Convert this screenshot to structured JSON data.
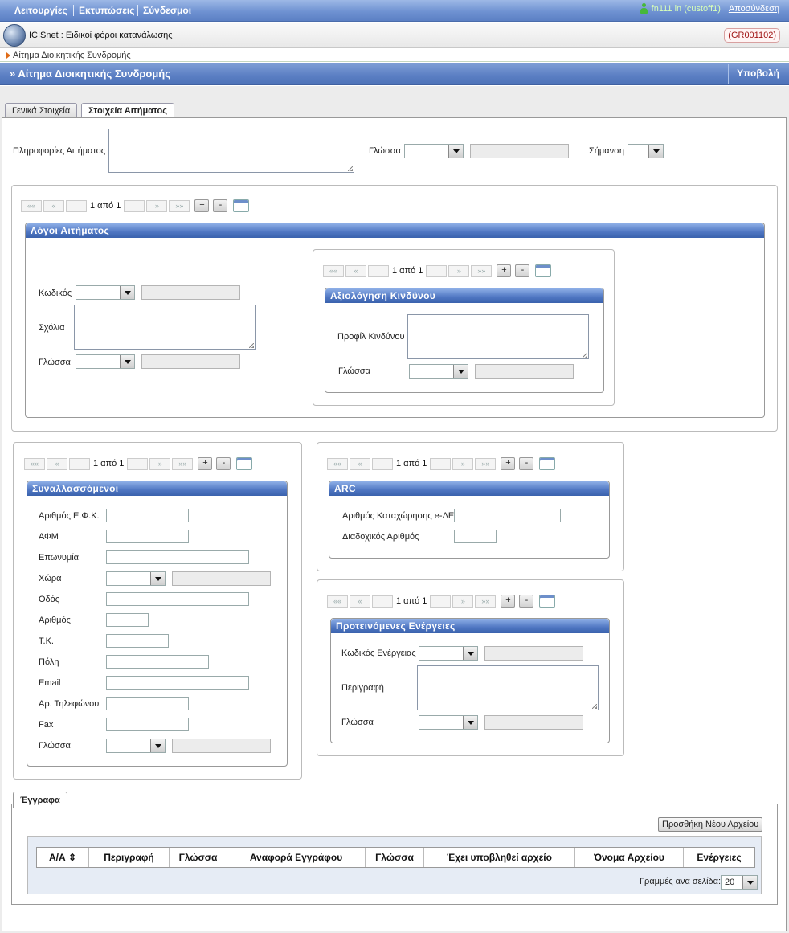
{
  "topmenu": {
    "items": [
      "Λειτουργίες",
      "Εκτυπώσεις",
      "Σύνδεσμοι"
    ]
  },
  "user": {
    "name": "fn111 ln (custoff1)",
    "logout": "Αποσύνδεση",
    "icon": "user-icon"
  },
  "app": {
    "title": "ICISnet : Ειδικοί φόροι κατανάλωσης",
    "code": "(GR001102)"
  },
  "breadcrumb": {
    "label": "Αίτημα Διοικητικής Συνδρομής"
  },
  "page": {
    "title": "» Αίτημα Διοικητικής Συνδρομής",
    "submit": "Υποβολή"
  },
  "tabs": [
    {
      "label": "Γενικά Στοιχεία",
      "active": false
    },
    {
      "label": "Στοιχεία Αιτήματος",
      "active": true
    }
  ],
  "request": {
    "info_label": "Πληροφορίες Αιτήματος",
    "language_label": "Γλώσσα",
    "marking_label": "Σήμανση"
  },
  "pager": {
    "text": "1 από 1",
    "first": "««",
    "prev": "«",
    "next": "»",
    "last": "»»",
    "add": "+",
    "remove": "-"
  },
  "reasons": {
    "title": "Λόγοι Αιτήματος",
    "code_label": "Κωδικός",
    "comments_label": "Σχόλια",
    "language_label": "Γλώσσα"
  },
  "risk": {
    "title": "Αξιολόγηση Κινδύνου",
    "profile_label": "Προφίλ Κινδύνου",
    "language_label": "Γλώσσα"
  },
  "traders": {
    "title": "Συναλλασσόμενοι",
    "fields": [
      "Αριθμός Ε.Φ.Κ.",
      "ΑΦΜ",
      "Επωνυμία",
      "Χώρα",
      "Οδός",
      "Αριθμός",
      "Τ.Κ.",
      "Πόλη",
      "Email",
      "Αρ. Τηλεφώνου",
      "Fax",
      "Γλώσσα"
    ]
  },
  "arc": {
    "title": "ARC",
    "reg_label": "Αριθμός Καταχώρησης e-ΔΕ",
    "seq_label": "Διαδοχικός Αριθμός"
  },
  "actions": {
    "title": "Προτεινόμενες Ενέργειες",
    "code_label": "Κωδικός Ενέργειας",
    "desc_label": "Περιγραφή",
    "language_label": "Γλώσσα"
  },
  "documents": {
    "tab": "Έγγραφα",
    "add_button": "Προσθήκη Νέου Αρχείου",
    "columns": [
      "Α/Α ⇕",
      "Περιγραφή",
      "Γλώσσα",
      "Αναφορά Εγγράφου",
      "Γλώσσα",
      "Έχει υποβληθεί αρχείο",
      "Όνομα Αρχείου",
      "Ενέργειες"
    ],
    "rows_per_page_label": "Γραμμές ανα σελίδα:",
    "rows_per_page": "20"
  }
}
